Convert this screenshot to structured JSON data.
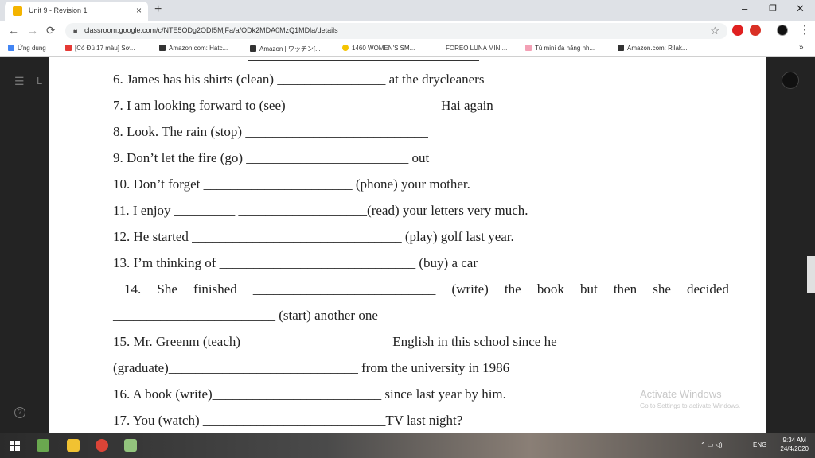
{
  "browser": {
    "tab_title": "Unit 9 - Revision 1",
    "tab_close": "×",
    "new_tab": "+",
    "minimize": "–",
    "maximize": "❐",
    "close": "✕",
    "url": "classroom.google.com/c/NTE5ODg2ODI5MjFa/a/ODk2MDA0MzQ1MDla/details",
    "back": "←",
    "forward": "→",
    "reload": "⟳",
    "star": "☆",
    "menu": "⋮"
  },
  "bookmarks": {
    "apps": "Ứng dụng",
    "items": [
      "[Có Đủ 17 màu] Sơ...",
      "Amazon.com: Hatc...",
      "Amazon | ワッチン[...",
      "1460 WOMEN'S SM...",
      "FOREO LUNA MINI...",
      "Tủ mini đa năng nh...",
      "Amazon.com: Rilak..."
    ],
    "more": "»"
  },
  "viewer": {
    "side_letter": "L"
  },
  "exercise": {
    "lines": [
      "6. James has his shirts (clean) ________________ at the drycleaners",
      "7. I am looking forward to (see) ______________________ Hai again",
      "8. Look. The rain (stop) ___________________________",
      "9. Don’t let the fire (go) ________________________ out",
      "10. Don’t forget ______________________ (phone) your mother.",
      "11. I enjoy _________ ___________________(read) your letters very much.",
      "12. He started _______________________________ (play) golf last year.",
      "13. I’m thinking of _____________________________ (buy) a car"
    ],
    "line14_words": [
      "14.",
      "She",
      "finished",
      "___________________________",
      "(write)",
      "the",
      "book",
      "but",
      "then",
      "she",
      "decided"
    ],
    "lines_after": [
      "________________________ (start) another one",
      "15. Mr. Greenm (teach)______________________ English in this school since he",
      "(graduate)____________________________ from the university in 1986",
      "16. A book (write)_________________________ since last year by him.",
      "17. You (watch) ___________________________TV last night?"
    ]
  },
  "watermark": {
    "title": "Activate Windows",
    "subtitle": "Go to Settings to activate Windows."
  },
  "taskbar": {
    "tray": "ENG",
    "time": "9:34 AM",
    "date": "24/4/2020"
  }
}
